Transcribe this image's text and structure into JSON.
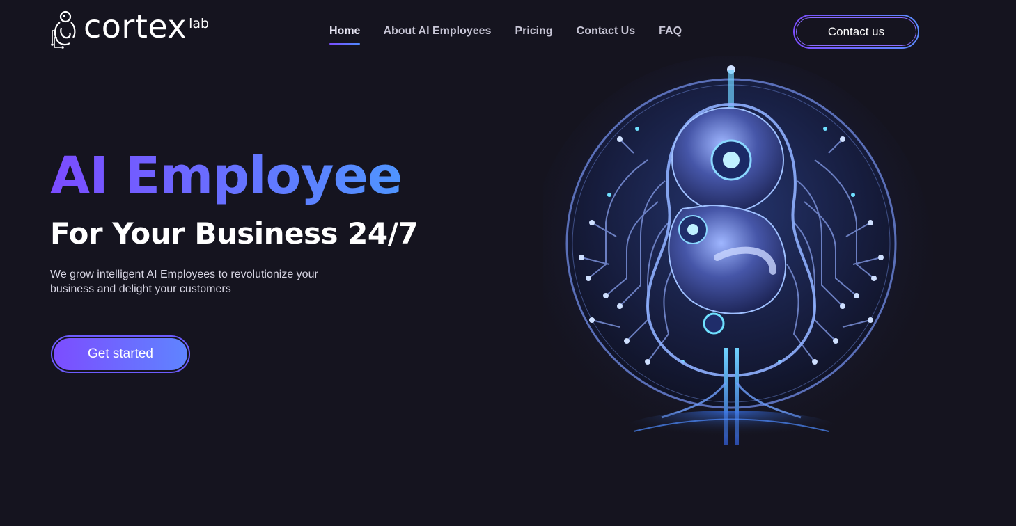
{
  "brand": {
    "name": "cortex",
    "suffix": "lab",
    "logo_icon": "embryo-circuit-icon"
  },
  "nav": {
    "items": [
      {
        "label": "Home",
        "active": true
      },
      {
        "label": "About AI Employees",
        "active": false
      },
      {
        "label": "Pricing",
        "active": false
      },
      {
        "label": "Contact Us",
        "active": false
      },
      {
        "label": "FAQ",
        "active": false
      }
    ],
    "cta_label": "Contact us"
  },
  "hero": {
    "title": "AI Employee",
    "subtitle": "For Your Business 24/7",
    "description": "We grow intelligent AI Employees to revolutionize your business and delight your customers",
    "cta_label": "Get started",
    "illustration": "robot-embryo-circuit-tree-illustration"
  },
  "colors": {
    "background": "#15141f",
    "accent_start": "#7b4cff",
    "accent_end": "#4f95ff",
    "text_primary": "#ffffff",
    "text_secondary": "#d7d5e3"
  }
}
